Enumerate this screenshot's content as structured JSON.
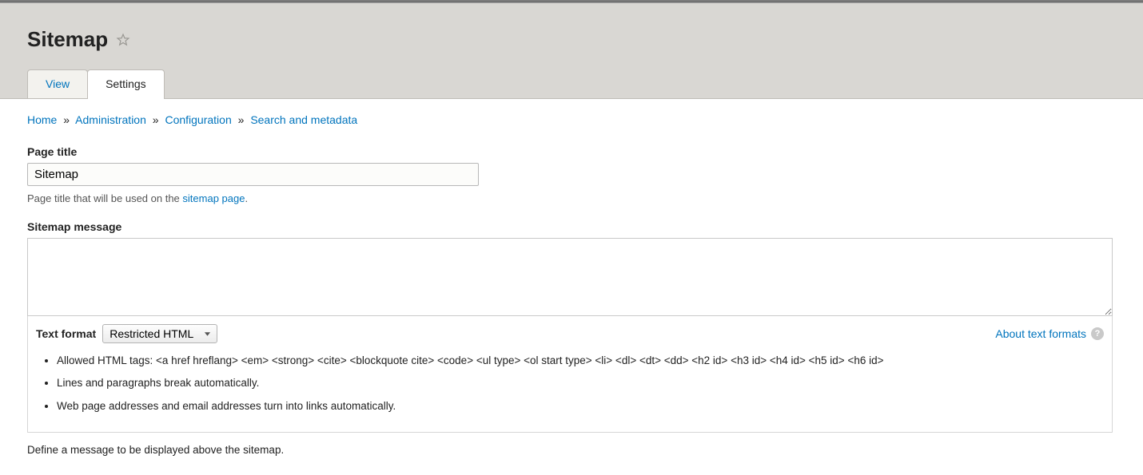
{
  "page": {
    "title": "Sitemap"
  },
  "tabs": {
    "view": "View",
    "settings": "Settings"
  },
  "breadcrumb": {
    "home": "Home",
    "administration": "Administration",
    "configuration": "Configuration",
    "search_metadata": "Search and metadata",
    "sep": "»"
  },
  "form": {
    "page_title": {
      "label": "Page title",
      "value": "Sitemap",
      "description_prefix": "Page title that will be used on the ",
      "description_link": "sitemap page",
      "description_suffix": "."
    },
    "sitemap_message": {
      "label": "Sitemap message",
      "value": "",
      "below": "Define a message to be displayed above the sitemap."
    },
    "text_format": {
      "label": "Text format",
      "selected": "Restricted HTML",
      "about_link": "About text formats",
      "tips": [
        "Allowed HTML tags: <a href hreflang> <em> <strong> <cite> <blockquote cite> <code> <ul type> <ol start type> <li> <dl> <dt> <dd> <h2 id> <h3 id> <h4 id> <h5 id> <h6 id>",
        "Lines and paragraphs break automatically.",
        "Web page addresses and email addresses turn into links automatically."
      ]
    }
  }
}
